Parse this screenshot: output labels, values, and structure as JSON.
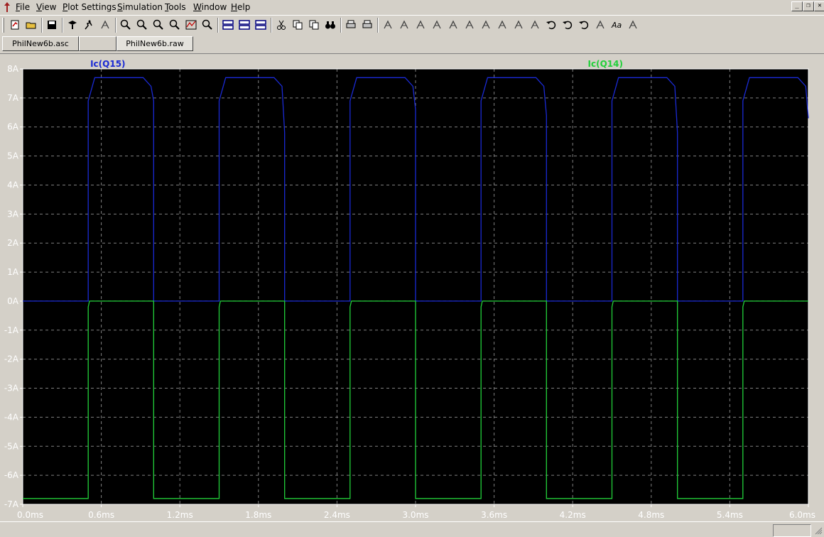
{
  "menubar": {
    "items": [
      {
        "label": "File",
        "underline": "F",
        "rest": "ile"
      },
      {
        "label": "View",
        "underline": "V",
        "rest": "iew"
      },
      {
        "label": "Plot Settings",
        "underline": "P",
        "rest": "lot Settings"
      },
      {
        "label": "Simulation",
        "underline": "S",
        "rest": "imulation"
      },
      {
        "label": "Tools",
        "underline": "T",
        "rest": "ools"
      },
      {
        "label": "Window",
        "underline": "W",
        "rest": "indow"
      },
      {
        "label": "Help",
        "underline": "H",
        "rest": "elp"
      }
    ]
  },
  "window_controls": [
    "minimize-icon",
    "restore-icon",
    "close-icon"
  ],
  "toolbar_icons": [
    "new-schematic-icon",
    "open-icon",
    "save-icon",
    "control-panel-icon",
    "run-icon",
    "halt-icon",
    "zoom-in-icon",
    "zoom-area-icon",
    "zoom-out-icon",
    "zoom-cancel-icon",
    "autorange-icon",
    "zoom-fit-icon",
    "tile-horizontal-icon",
    "cascade-icon",
    "tile-vertical-icon",
    "cut-icon",
    "copy-icon",
    "paste-icon",
    "find-icon",
    "print-preview-icon",
    "print-icon",
    "wire-icon",
    "ground-icon",
    "label-net-icon",
    "resistor-icon",
    "capacitor-icon",
    "inductor-icon",
    "diode-icon",
    "component-icon",
    "move-icon",
    "drag-icon",
    "undo-icon",
    "redo-icon",
    "rotate-icon",
    "mirror-icon",
    "text-icon",
    "spice-directive-icon"
  ],
  "tabs": [
    {
      "label": "PhilNew6b.asc",
      "active": false
    },
    {
      "label": "",
      "active": false
    },
    {
      "label": "PhilNew6b.raw",
      "active": true
    }
  ],
  "colors": {
    "plot_background": "#000000",
    "grid": "#808080",
    "axis_text": "#ffffff",
    "series_q15": "#1a2ad4",
    "series_q14": "#22d03a"
  },
  "chart_data": {
    "type": "line",
    "xlabel": "",
    "ylabel": "",
    "x_unit": "ms",
    "y_unit": "A",
    "xlim": [
      0.0,
      6.0
    ],
    "ylim": [
      -7,
      8
    ],
    "x_ticks": [
      "0.0ms",
      "0.6ms",
      "1.2ms",
      "1.8ms",
      "2.4ms",
      "3.0ms",
      "3.6ms",
      "4.2ms",
      "4.8ms",
      "5.4ms",
      "6.0ms"
    ],
    "y_ticks": [
      "8A",
      "7A",
      "6A",
      "5A",
      "4A",
      "3A",
      "2A",
      "1A",
      "0A",
      "-1A",
      "-2A",
      "-3A",
      "-4A",
      "-5A",
      "-6A",
      "-7A"
    ],
    "grid": true,
    "series": [
      {
        "name": "Ic(Q15)",
        "x": [
          0.0,
          0.5,
          0.5,
          0.55,
          0.92,
          0.98,
          1.0,
          1.0,
          1.5,
          1.5,
          1.55,
          1.92,
          1.98,
          2.0,
          2.0,
          2.5,
          2.5,
          2.55,
          2.92,
          2.98,
          3.0,
          3.0,
          3.5,
          3.5,
          3.55,
          3.92,
          3.98,
          4.0,
          4.0,
          4.5,
          4.5,
          4.55,
          4.92,
          4.98,
          5.0,
          5.0,
          5.5,
          5.5,
          5.55,
          5.92,
          5.98,
          6.0
        ],
        "y": [
          0,
          0,
          6.9,
          7.7,
          7.7,
          7.4,
          6.9,
          0,
          0,
          6.9,
          7.7,
          7.7,
          7.4,
          5.8,
          0,
          0,
          6.9,
          7.7,
          7.7,
          7.4,
          6.6,
          0,
          0,
          6.9,
          7.7,
          7.7,
          7.4,
          6.4,
          0,
          0,
          6.9,
          7.7,
          7.7,
          7.4,
          5.8,
          0,
          0,
          6.9,
          7.7,
          7.7,
          7.4,
          6.3
        ]
      },
      {
        "name": "Ic(Q14)",
        "x": [
          0.0,
          0.5,
          0.5,
          0.51,
          1.0,
          1.0,
          1.5,
          1.5,
          1.51,
          2.0,
          2.0,
          2.5,
          2.5,
          2.51,
          3.0,
          3.0,
          3.5,
          3.5,
          3.51,
          4.0,
          4.0,
          4.5,
          4.5,
          4.51,
          5.0,
          5.0,
          5.5,
          5.5,
          5.51,
          6.0
        ],
        "y": [
          -6.8,
          -6.8,
          -0.2,
          0,
          0,
          -6.8,
          -6.8,
          -0.2,
          0,
          0,
          -6.8,
          -6.8,
          -0.2,
          0,
          0,
          -6.8,
          -6.8,
          -0.2,
          0,
          0,
          -6.8,
          -6.8,
          -0.2,
          0,
          0,
          -6.8,
          -6.8,
          -0.2,
          0,
          0
        ]
      }
    ]
  }
}
